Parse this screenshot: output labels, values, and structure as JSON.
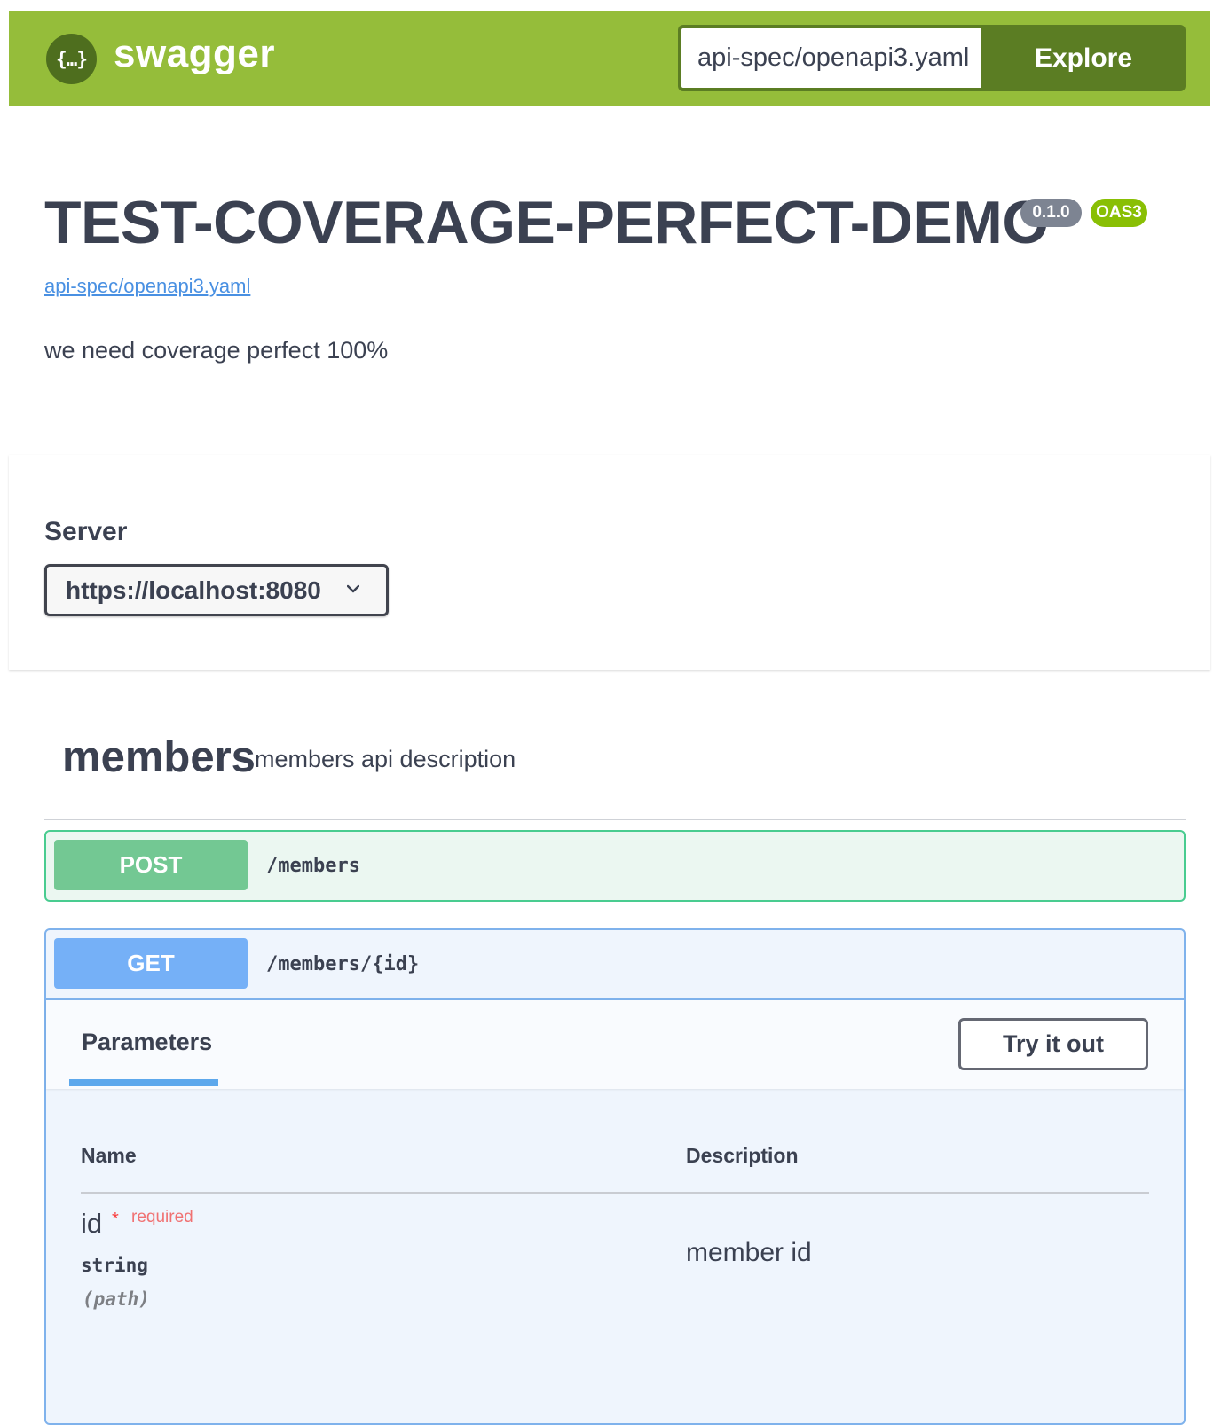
{
  "topbar": {
    "logo_glyph": "{…}",
    "logo_text": "swagger",
    "url_value": "api-spec/openapi3.yaml",
    "explore_label": "Explore",
    "colors": {
      "bar": "#95bd3a",
      "dark": "#5b7d23"
    }
  },
  "info": {
    "title": "TEST-COVERAGE-PERFECT-DEMO",
    "version": "0.1.0",
    "oas_badge": "OAS3",
    "spec_link": "api-spec/openapi3.yaml",
    "description": "we need coverage perfect 100%"
  },
  "servers": {
    "label": "Server",
    "selected": "https://localhost:8080"
  },
  "tag": {
    "name": "members",
    "description": "members api description"
  },
  "operations": [
    {
      "method": "POST",
      "path": "/members",
      "color": "#49cc90"
    },
    {
      "method": "GET",
      "path": "/members/{id}",
      "color": "#61affe",
      "parameters_title": "Parameters",
      "try_label": "Try it out",
      "columns": {
        "name": "Name",
        "description": "Description"
      },
      "params": [
        {
          "name": "id",
          "required_star": "*",
          "required_label": "required",
          "type": "string",
          "in": "(path)",
          "description": "member id"
        }
      ]
    }
  ]
}
